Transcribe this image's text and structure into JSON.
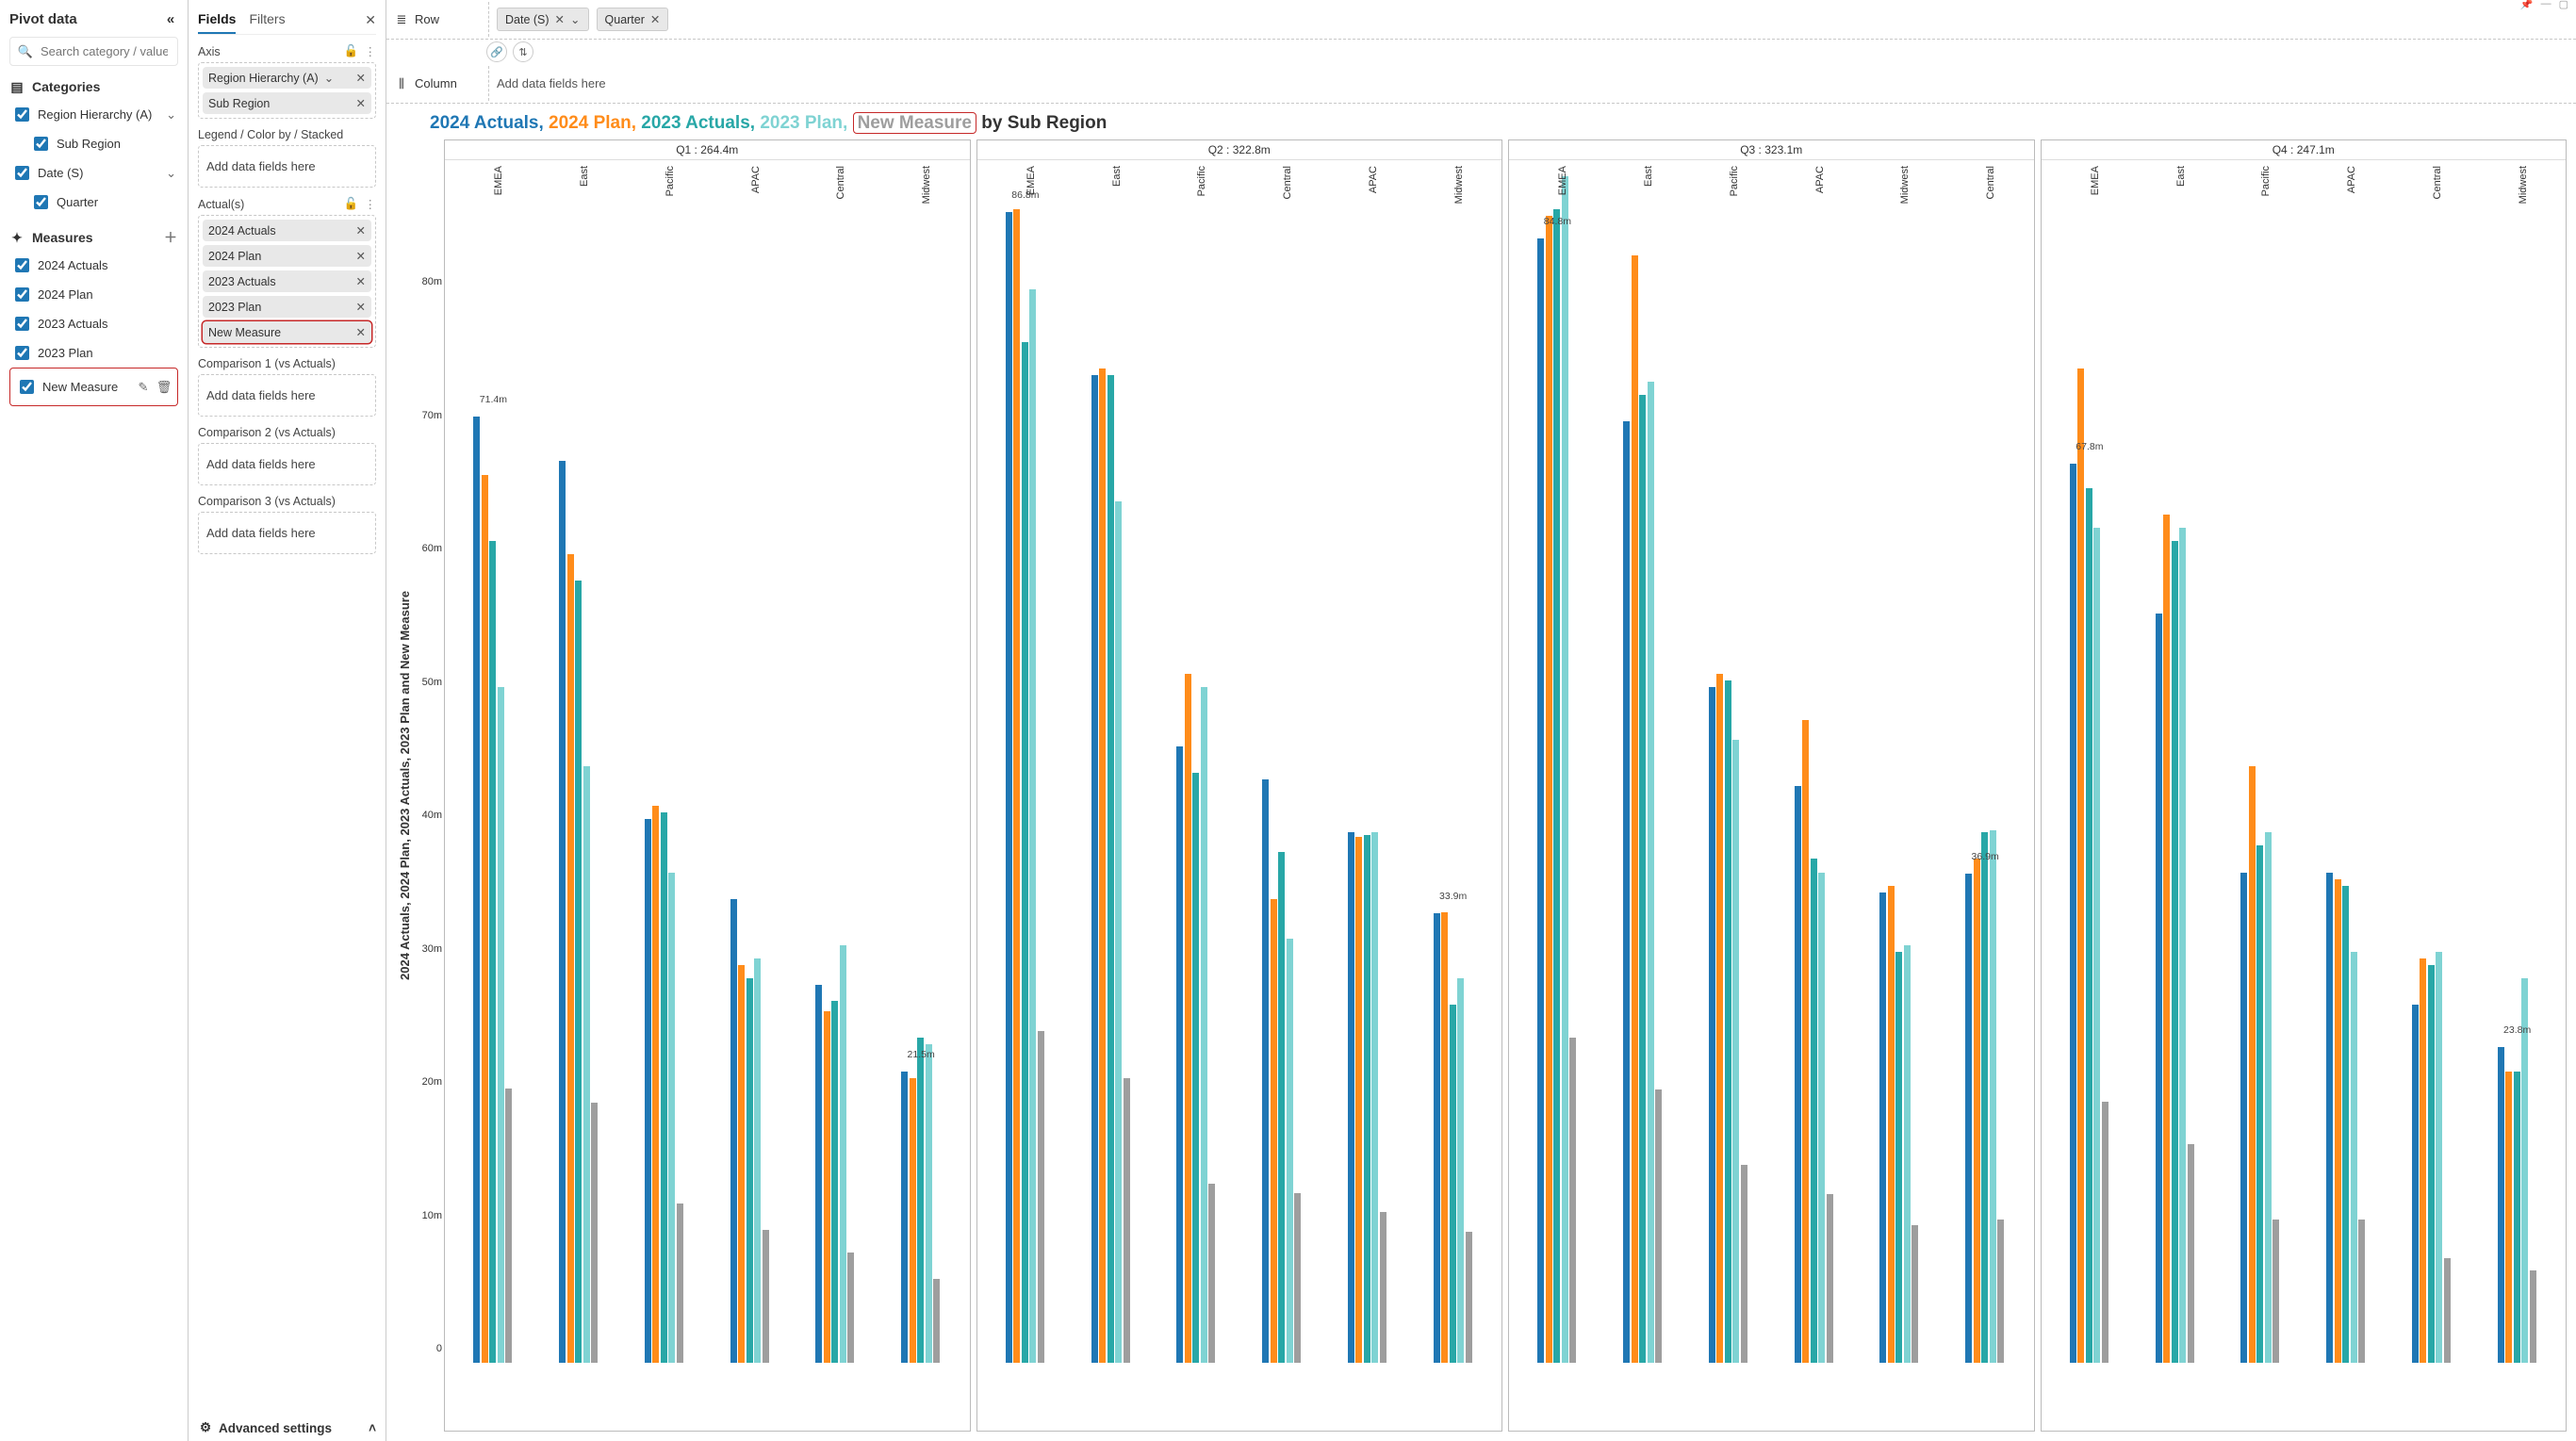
{
  "pivot": {
    "title": "Pivot data",
    "search_placeholder": "Search category / value",
    "categories_title": "Categories",
    "measures_title": "Measures",
    "categories": [
      {
        "label": "Region Hierarchy (A)",
        "indent": 0,
        "expand": true
      },
      {
        "label": "Sub Region",
        "indent": 1,
        "expand": false
      },
      {
        "label": "Date (S)",
        "indent": 0,
        "expand": true
      },
      {
        "label": "Quarter",
        "indent": 1,
        "expand": false
      }
    ],
    "measures": [
      {
        "label": "2024 Actuals"
      },
      {
        "label": "2024 Plan"
      },
      {
        "label": "2023 Actuals"
      },
      {
        "label": "2023 Plan"
      },
      {
        "label": "New Measure",
        "highlight": true
      }
    ]
  },
  "fields": {
    "tab_fields": "Fields",
    "tab_filters": "Filters",
    "sections": {
      "axis_title": "Axis",
      "axis_items": [
        {
          "label": "Region Hierarchy (A)",
          "caret": true
        },
        {
          "label": "Sub Region"
        }
      ],
      "legend_title": "Legend / Color by / Stacked",
      "actuals_title": "Actual(s)",
      "actual_items": [
        {
          "label": "2024 Actuals"
        },
        {
          "label": "2024 Plan"
        },
        {
          "label": "2023 Actuals"
        },
        {
          "label": "2023 Plan"
        },
        {
          "label": "New Measure",
          "highlight": true
        }
      ],
      "comp1_title": "Comparison 1 (vs Actuals)",
      "comp2_title": "Comparison 2 (vs Actuals)",
      "comp3_title": "Comparison 3 (vs Actuals)",
      "drop_text": "Add data fields here"
    },
    "advanced": "Advanced settings"
  },
  "shelf": {
    "row_label": "Row",
    "column_label": "Column",
    "row_chips": [
      {
        "label": "Date (S)",
        "caret": true
      },
      {
        "label": "Quarter"
      }
    ],
    "col_placeholder": "Add data fields here"
  },
  "title_parts": {
    "p1": "2024 Actuals, ",
    "p2": "2024 Plan, ",
    "p3": "2023 Actuals, ",
    "p4": "2023 Plan, ",
    "p5": "New Measure",
    "rest": " by Sub Region"
  },
  "chart_data": {
    "type": "bar",
    "ylabel": "2024 Actuals, 2024 Plan, 2023 Actuals, 2023 Plan and New Measure",
    "ylim": [
      0,
      90
    ],
    "yticks": [
      0,
      10,
      20,
      30,
      40,
      50,
      60,
      70,
      80
    ],
    "series_names": [
      "2024 Actuals",
      "2024 Plan",
      "2023 Actuals",
      "2023 Plan",
      "New Measure"
    ],
    "series_colors": [
      "#1f77b4",
      "#ff8c1a",
      "#28a7a7",
      "#7fd3d3",
      "#9e9e9e"
    ],
    "panels": [
      {
        "title": "Q1 : 264.4m",
        "first_label": "71.4m",
        "last_label": "21.5m",
        "categories": [
          "EMEA",
          "East",
          "Pacific",
          "APAC",
          "Central",
          "Midwest"
        ],
        "series": [
          {
            "name": "2024 Actuals",
            "values": [
              71.4,
              68,
              41,
              35,
              28.5,
              22
            ]
          },
          {
            "name": "2024 Plan",
            "values": [
              67,
              61,
              42,
              30,
              26.5,
              21.5
            ]
          },
          {
            "name": "2023 Actuals",
            "values": [
              62,
              59,
              41.5,
              29,
              27.3,
              24.5
            ]
          },
          {
            "name": "2023 Plan",
            "values": [
              51,
              45,
              37,
              30.5,
              31.5,
              24
            ]
          },
          {
            "name": "New Measure",
            "values": [
              20.7,
              19.6,
              12,
              10,
              8.3,
              6.3
            ]
          }
        ]
      },
      {
        "title": "Q2 : 322.8m",
        "first_label": "86.8m",
        "last_label": "33.9m",
        "categories": [
          "EMEA",
          "East",
          "Pacific",
          "Central",
          "APAC",
          "Midwest"
        ],
        "series": [
          {
            "name": "2024 Actuals",
            "values": [
              86.8,
              74.5,
              46.5,
              44,
              40,
              33.9
            ]
          },
          {
            "name": "2024 Plan",
            "values": [
              87,
              75,
              52,
              35,
              39.7,
              34
            ]
          },
          {
            "name": "2023 Actuals",
            "values": [
              77,
              74.5,
              44.5,
              38.5,
              39.8,
              27
            ]
          },
          {
            "name": "2023 Plan",
            "values": [
              81,
              65,
              51,
              32,
              40,
              29
            ]
          },
          {
            "name": "New Measure",
            "values": [
              25,
              21.5,
              13.5,
              12.8,
              11.4,
              9.9
            ]
          }
        ]
      },
      {
        "title": "Q3 : 323.1m",
        "first_label": "84.8m",
        "last_label": "36.9m",
        "categories": [
          "EMEA",
          "East",
          "Pacific",
          "APAC",
          "Midwest",
          "Central"
        ],
        "series": [
          {
            "name": "2024 Actuals",
            "values": [
              84.8,
              71,
              51,
              43.5,
              35.5,
              36.9
            ]
          },
          {
            "name": "2024 Plan",
            "values": [
              86.5,
              83.5,
              52,
              48.5,
              36,
              38
            ]
          },
          {
            "name": "2023 Actuals",
            "values": [
              87,
              73,
              51.5,
              38,
              31,
              40
            ]
          },
          {
            "name": "2023 Plan",
            "values": [
              89.5,
              74,
              47,
              37,
              31.5,
              40.2
            ]
          },
          {
            "name": "New Measure",
            "values": [
              24.5,
              20.6,
              14.9,
              12.7,
              10.4,
              10.8
            ]
          }
        ]
      },
      {
        "title": "Q4 : 247.1m",
        "first_label": "67.8m",
        "last_label": "23.8m",
        "categories": [
          "EMEA",
          "East",
          "Pacific",
          "APAC",
          "Central",
          "Midwest"
        ],
        "series": [
          {
            "name": "2024 Actuals",
            "values": [
              67.8,
              56.5,
              37,
              37,
              27,
              23.8
            ]
          },
          {
            "name": "2024 Plan",
            "values": [
              75,
              64,
              45,
              36.5,
              30.5,
              22
            ]
          },
          {
            "name": "2023 Actuals",
            "values": [
              66,
              62,
              39,
              36,
              30,
              22
            ]
          },
          {
            "name": "2023 Plan",
            "values": [
              63,
              63,
              40,
              31,
              31,
              29
            ]
          },
          {
            "name": "New Measure",
            "values": [
              19.7,
              16.5,
              10.8,
              10.8,
              7.9,
              7
            ]
          }
        ]
      }
    ]
  }
}
